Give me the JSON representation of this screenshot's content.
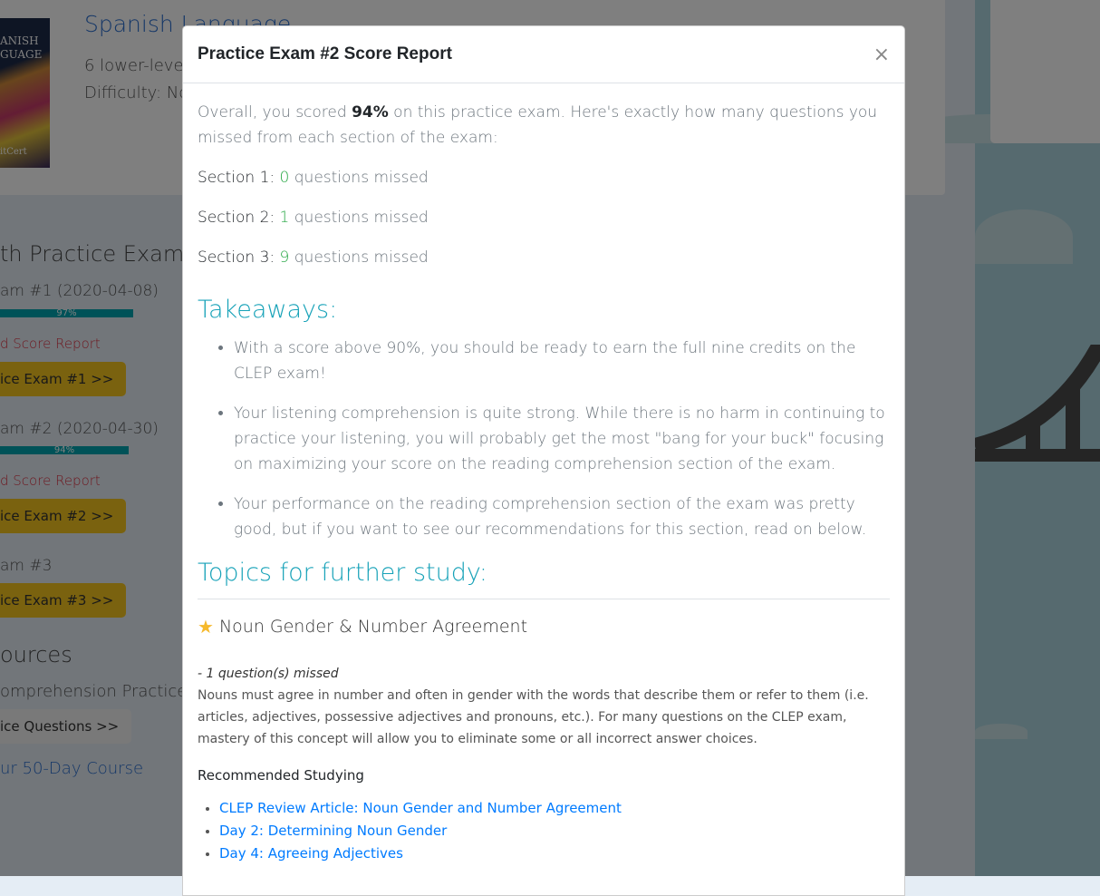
{
  "background": {
    "course_title": "Spanish Language",
    "book_cover_text": [
      "ANISH",
      "GUAGE",
      "itCert"
    ],
    "credits_line": "6 lower-level",
    "difficulty_line": "Difficulty: No",
    "section_heading": "th Practice Exams",
    "exams": [
      {
        "label": "am #1 (2020-04-08)",
        "progress_percent": 97,
        "progress_label": "97%",
        "report_link": "d Score Report",
        "button": "ice Exam #1 >>"
      },
      {
        "label": "am #2 (2020-04-30)",
        "progress_percent": 94,
        "progress_label": "94%",
        "report_link": "d Score Report",
        "button": "ice Exam #2 >>"
      },
      {
        "label": "am #3",
        "button": "ice Exam #3 >>"
      }
    ],
    "resources_heading": "ources",
    "resource_item": "omprehension Practice Q",
    "resource_button": "ice Questions >>",
    "course_link": "ur 50-Day Course"
  },
  "modal": {
    "title": "Practice Exam #2 Score Report",
    "close_label": "×",
    "intro_before": "Overall, you scored ",
    "score": "94%",
    "intro_after": " on this practice exam. Here's exactly how many questions you missed from each section of the exam:",
    "sections": [
      {
        "label": "Section 1:",
        "missed": "0",
        "suffix": " questions missed"
      },
      {
        "label": "Section 2:",
        "missed": "1",
        "suffix": " questions missed"
      },
      {
        "label": "Section 3:",
        "missed": "9",
        "suffix": " questions missed"
      }
    ],
    "takeaways_heading": "Takeaways:",
    "takeaways": [
      "With a score above 90%, you should be ready to earn the full nine credits on the CLEP exam!",
      "Your listening comprehension is quite strong. While there is no harm in continuing to practice your listening, you will probably get the most \"bang for your buck\" focusing on maximizing your score on the reading comprehension section of the exam.",
      "Your performance on the reading comprehension section of the exam was pretty good, but if you want to see our recommendations for this section, read on below."
    ],
    "topics_heading": "Topics for further study:",
    "topic": {
      "title": "Noun Gender & Number Agreement",
      "missed": "- 1 question(s) missed",
      "description": "Nouns must agree in number and often in gender with the words that describe them or refer to them (i.e. articles, adjectives, possessive adjectives and pronouns, etc.). For many questions on the CLEP exam, mastery of this concept will allow you to eliminate some or all incorrect answer choices.",
      "recommended_label": "Recommended Studying",
      "links": [
        "CLEP Review Article: Noun Gender and Number Agreement",
        "Day 2: Determining Noun Gender",
        "Day 4: Agreeing Adjectives"
      ]
    }
  },
  "colors": {
    "accent": "#17a2b8",
    "success": "#28a745",
    "link": "#007bff",
    "button": "#f4c41e",
    "progress": "#01a5b1"
  }
}
